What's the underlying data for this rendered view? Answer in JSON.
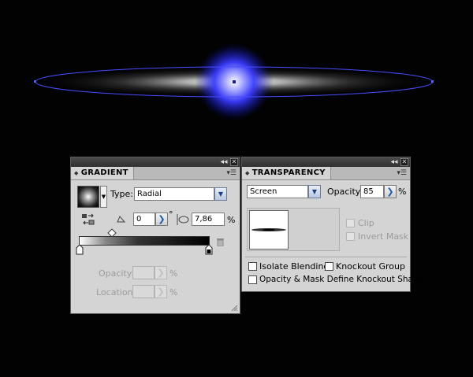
{
  "gradient_panel": {
    "tab_title": "GRADIENT",
    "type_label": "Type:",
    "type_value": "Radial",
    "angle_value": "0",
    "angle_unit": "°",
    "aspect_value": "7,86",
    "aspect_unit": "%",
    "opacity_label": "Opacity:",
    "opacity_unit": "%",
    "location_label": "Location:",
    "location_unit": "%"
  },
  "transparency_panel": {
    "tab_title": "TRANSPARENCY",
    "blend_mode": "Screen",
    "opacity_label": "Opacity:",
    "opacity_value": "85",
    "opacity_unit": "%",
    "clip_label": "Clip",
    "invert_mask_label": "Invert Mask",
    "isolate_blending_label": "Isolate Blending",
    "knockout_group_label": "Knockout Group",
    "opacity_mask_label": "Opacity & Mask Define Knockout Shape"
  },
  "icons": {
    "collapse": "double-left-arrow-icon",
    "close": "close-icon",
    "menu": "panel-menu-icon",
    "trash": "trash-icon",
    "reverse": "reverse-gradient-icon",
    "angle": "angle-icon",
    "aspect": "aspect-ratio-icon"
  },
  "colors": {
    "glow": "#3a3cff",
    "ellipse_stroke": "#4a4cff",
    "panel_bg": "#d4d4d4"
  }
}
